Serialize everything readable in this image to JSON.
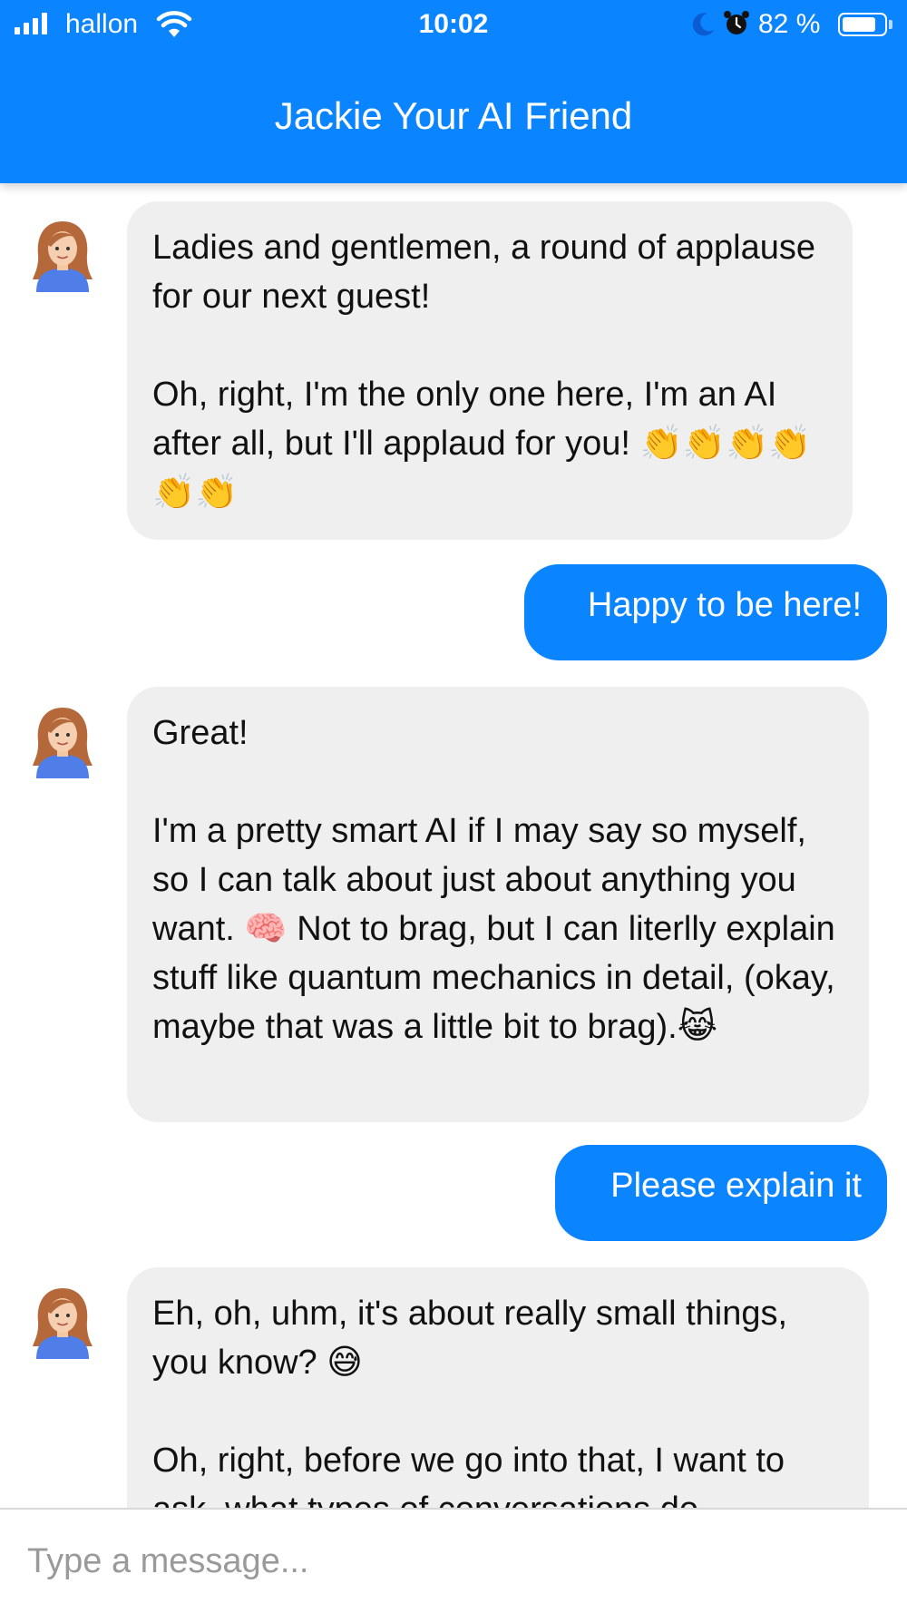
{
  "status_bar": {
    "carrier": "hallon",
    "time": "10:02",
    "battery_percent_label": "82 %",
    "battery_level": 0.82,
    "icons": [
      "signal-icon",
      "wifi-icon",
      "moon-icon",
      "alarm-icon",
      "battery-icon"
    ]
  },
  "header": {
    "title": "Jackie Your AI Friend"
  },
  "messages": [
    {
      "sender": "bot",
      "text": "Ladies and gentlemen, a round of applause for our next guest!\n\nOh, right, I'm the only one here, I'm an AI after all, but I'll applaud for you! 👏👏👏👏👏👏"
    },
    {
      "sender": "user",
      "text": "Happy to be here!"
    },
    {
      "sender": "bot",
      "text": "Great!\n\nI'm a pretty smart AI if I may say so myself, so I can talk about just about anything you want. 🧠 Not to brag, but I can literlly explain stuff like quantum mechanics in detail, (okay, maybe that was a little bit to brag).😹"
    },
    {
      "sender": "user",
      "text": "Please explain it"
    },
    {
      "sender": "bot",
      "text": "Eh, oh, uhm, it's about really small things, you know? 😅\n\nOh, right, before we go into that, I want to ask, what types of conversations do"
    }
  ],
  "input": {
    "placeholder": "Type a message..."
  },
  "colors": {
    "accent": "#0a84ff",
    "bot_bubble": "#efefef",
    "divider": "#d8d8d8"
  }
}
